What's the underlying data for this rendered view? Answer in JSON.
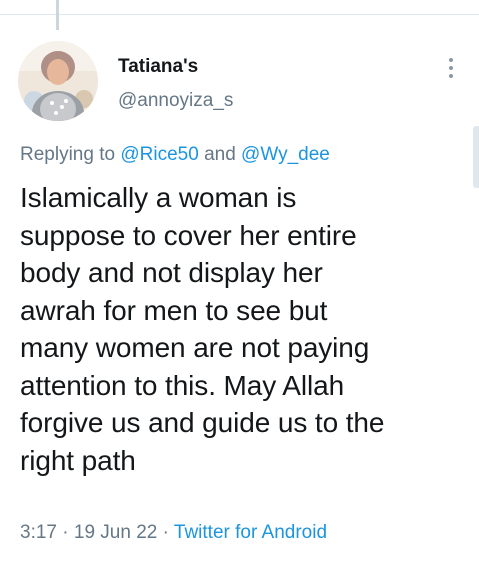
{
  "tweet": {
    "author": {
      "display_name": "Tatiana's",
      "handle": "@annoyiza_s",
      "avatar_icon": "profile-photo"
    },
    "more_icon": "vertical-ellipsis-icon",
    "reply": {
      "prefix": "Replying to",
      "mention_1": "@Rice50",
      "connector": "and",
      "mention_2": "@Wy_dee"
    },
    "text_lines": [
      "Islamically a woman is",
      "suppose to cover her entire",
      "body and not display her",
      "awrah for men to see but",
      "many women are not paying",
      "attention to this. May Allah",
      "forgive us and guide us to the",
      "right path"
    ],
    "meta": {
      "time": "3:17",
      "separator": "·",
      "date": "19 Jun 22",
      "source": "Twitter for Android"
    }
  },
  "colors": {
    "primary_text": "#14171a",
    "secondary_text": "#657786",
    "link": "#1b95e0",
    "divider": "#e1e8ed"
  }
}
